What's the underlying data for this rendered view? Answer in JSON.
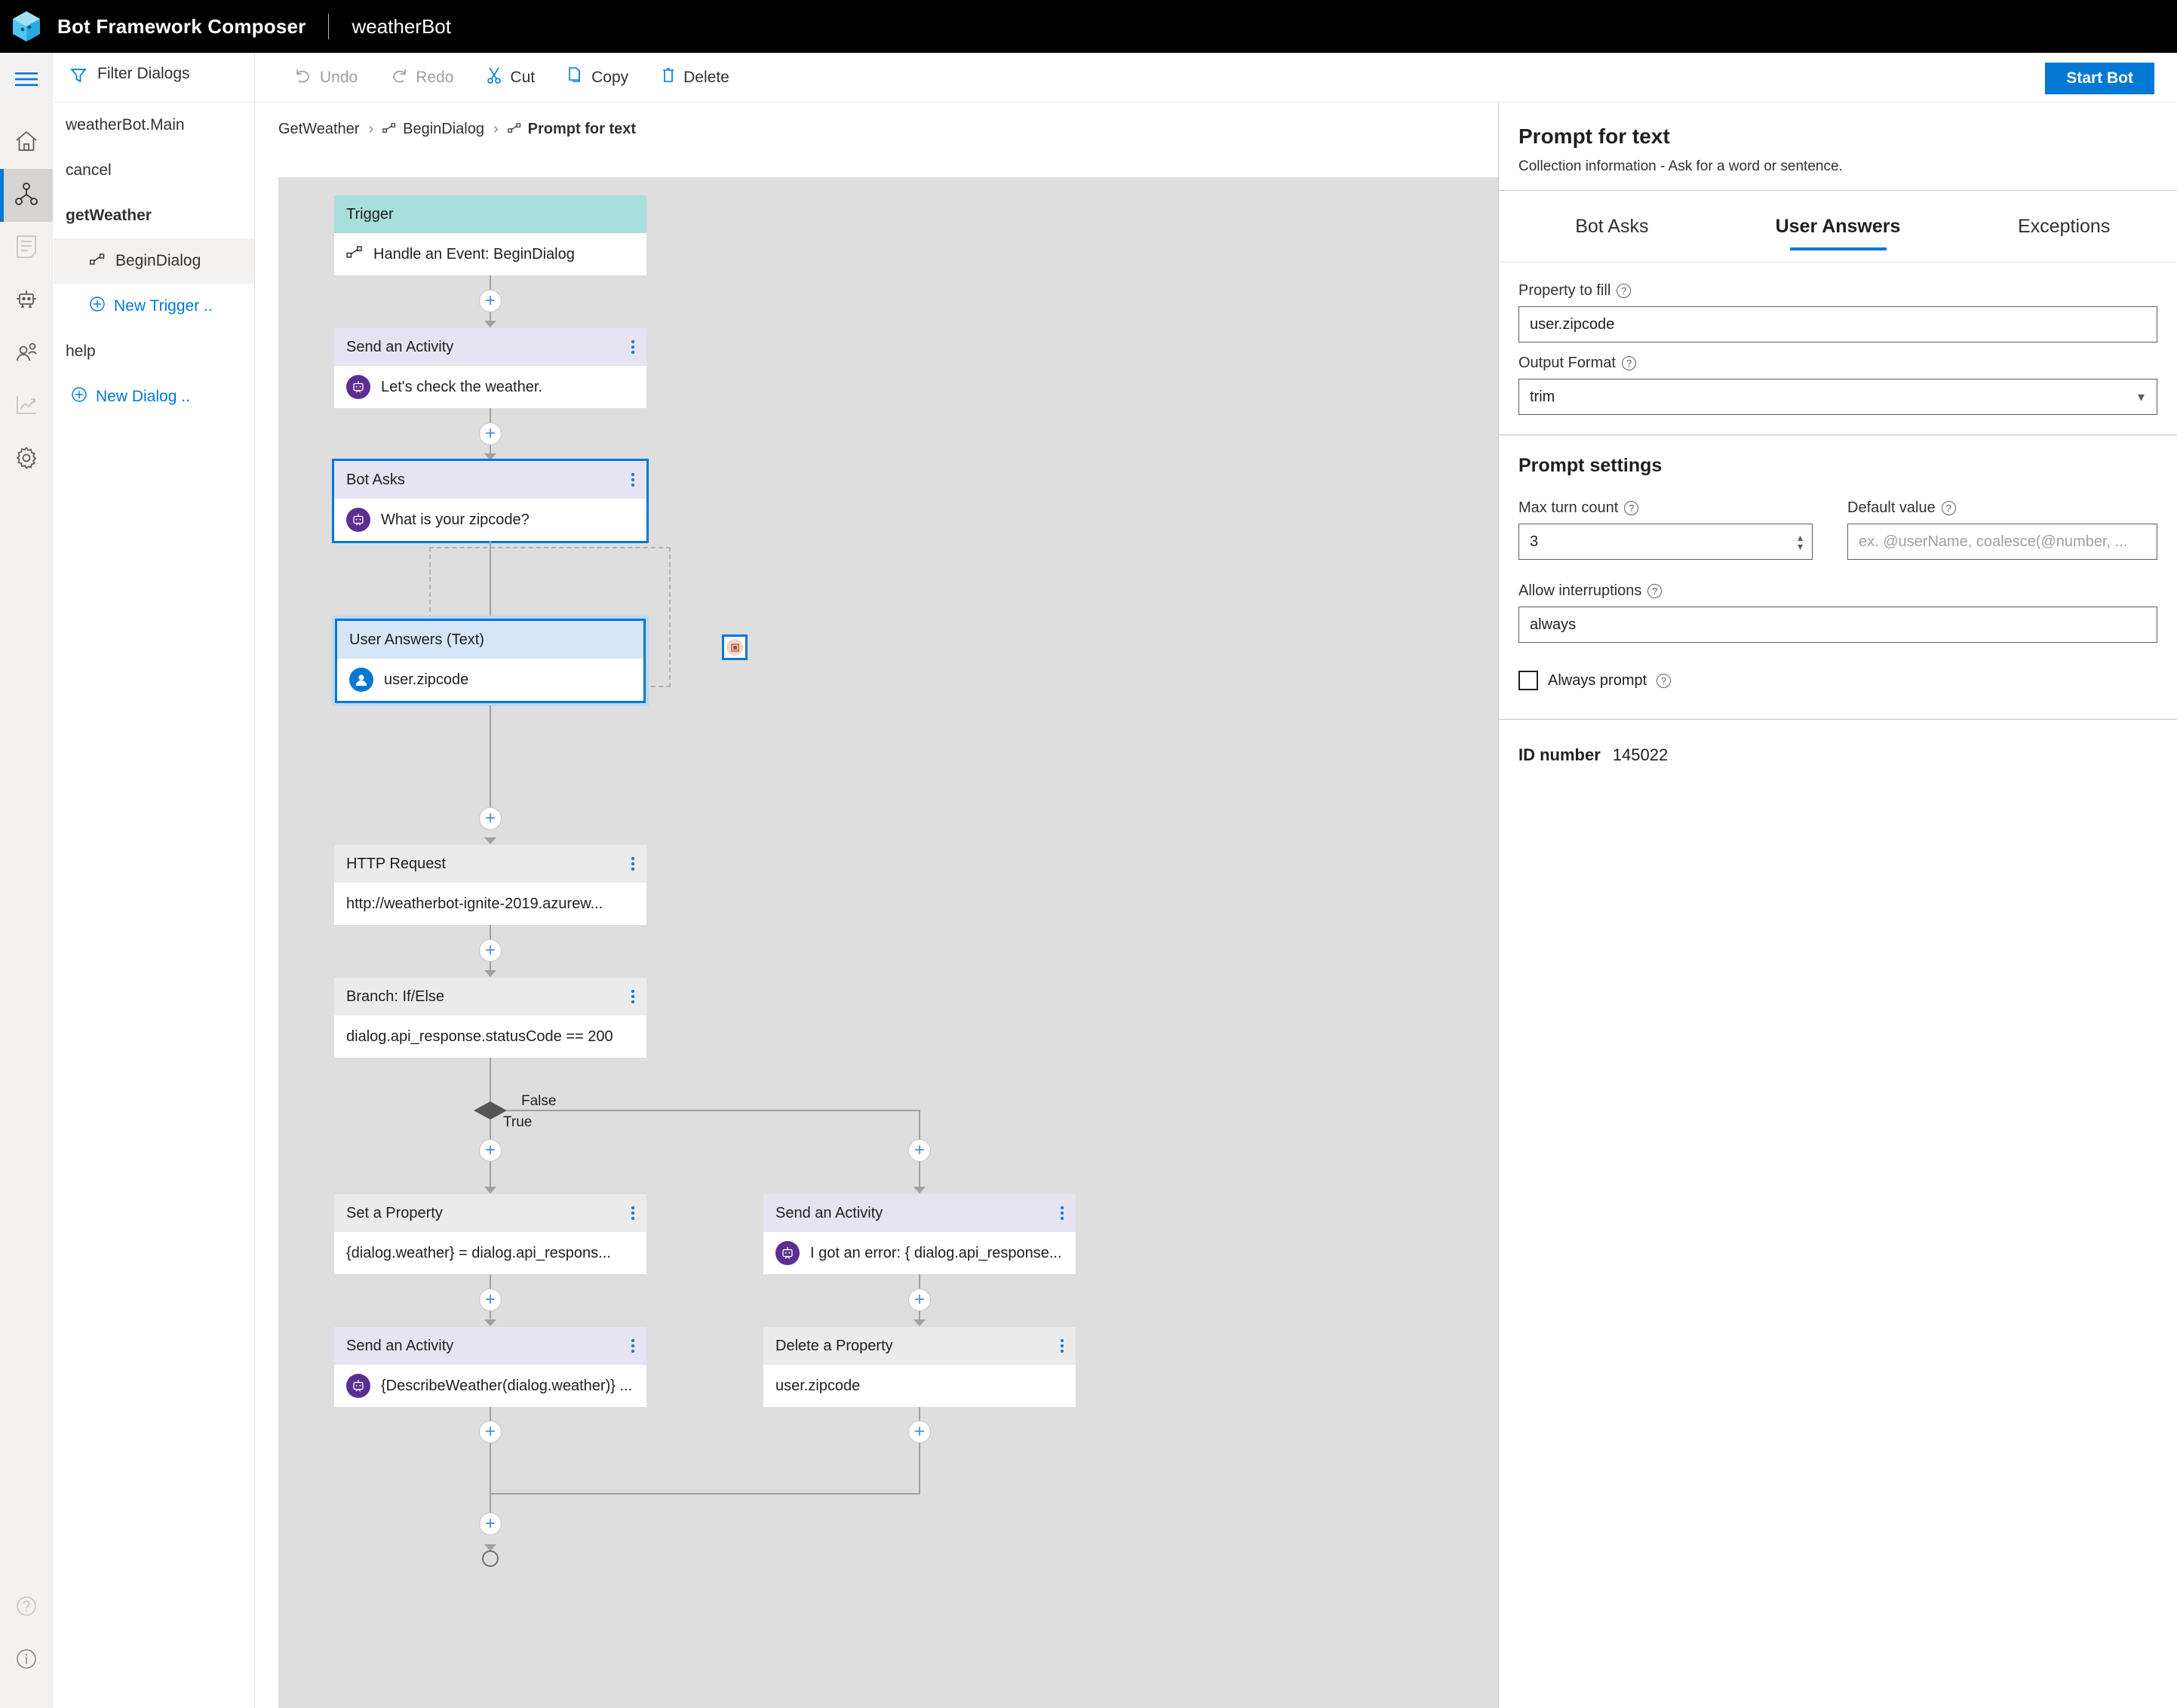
{
  "topbar": {
    "app_title": "Bot Framework Composer",
    "bot_name": "weatherBot",
    "logo_icon": "composer-cube-logo"
  },
  "rail": {
    "menu_icon": "hamburger-menu-icon",
    "items": [
      {
        "icon": "home-icon",
        "name": "home",
        "active": false,
        "disabled": false
      },
      {
        "icon": "dialog-flow-icon",
        "name": "design",
        "active": true,
        "disabled": false
      },
      {
        "icon": "content-list-icon",
        "name": "bot-responses",
        "active": false,
        "disabled": true
      },
      {
        "icon": "robot-icon",
        "name": "user-input",
        "active": false,
        "disabled": false
      },
      {
        "icon": "people-icon",
        "name": "skills",
        "active": false,
        "disabled": false
      },
      {
        "icon": "analytics-icon",
        "name": "evaluate-performance",
        "active": false,
        "disabled": true
      },
      {
        "icon": "gear-icon",
        "name": "settings",
        "active": false,
        "disabled": false
      }
    ],
    "bottom": [
      {
        "icon": "help-icon",
        "name": "help",
        "disabled": true
      },
      {
        "icon": "info-icon",
        "name": "about",
        "disabled": false
      }
    ]
  },
  "dialogs": {
    "filter_label": "Filter Dialogs",
    "filter_icon": "funnel-filter-icon",
    "items": [
      {
        "label": "weatherBot.Main",
        "level": 0,
        "bold": false,
        "selected": false,
        "type": "dialog"
      },
      {
        "label": "cancel",
        "level": 0,
        "bold": false,
        "selected": false,
        "type": "dialog"
      },
      {
        "label": "getWeather",
        "level": 0,
        "bold": true,
        "selected": false,
        "type": "dialog"
      },
      {
        "label": "BeginDialog",
        "level": 1,
        "bold": false,
        "selected": true,
        "type": "trigger",
        "icon": "trigger-flow-icon"
      },
      {
        "label": "New Trigger ..",
        "level": 1,
        "bold": false,
        "selected": false,
        "type": "link",
        "icon": "plus-circle-icon"
      },
      {
        "label": "help",
        "level": 0,
        "bold": false,
        "selected": false,
        "type": "dialog"
      },
      {
        "label": "New Dialog ..",
        "level": 0,
        "bold": false,
        "selected": false,
        "type": "link",
        "icon": "plus-circle-icon"
      }
    ]
  },
  "commandbar": {
    "items": [
      {
        "label": "Undo",
        "icon": "undo-icon",
        "disabled": true
      },
      {
        "label": "Redo",
        "icon": "redo-icon",
        "disabled": true
      },
      {
        "label": "Cut",
        "icon": "scissors-icon",
        "disabled": false
      },
      {
        "label": "Copy",
        "icon": "copy-icon",
        "disabled": false
      },
      {
        "label": "Delete",
        "icon": "trash-icon",
        "disabled": false
      }
    ],
    "start_bot_label": "Start Bot"
  },
  "breadcrumb": [
    {
      "label": "GetWeather",
      "icon": null,
      "bold": false
    },
    {
      "label": "BeginDialog",
      "icon": "trigger-flow-icon",
      "bold": false
    },
    {
      "label": "Prompt for text",
      "icon": "trigger-flow-icon",
      "bold": true
    }
  ],
  "canvas": {
    "nodes": {
      "trigger": {
        "header": "Trigger",
        "body": "Handle an Event: BeginDialog",
        "icon": "trigger-flow-icon"
      },
      "send_activity_1": {
        "header": "Send an Activity",
        "body": "Let's check the weather.",
        "icon": "bot-avatar-icon"
      },
      "bot_asks": {
        "header": "Bot Asks",
        "body": "What is your zipcode?",
        "icon": "bot-avatar-icon"
      },
      "user_answers": {
        "header": "User Answers (Text)",
        "body": "user.zipcode",
        "icon": "user-avatar-icon"
      },
      "http_request": {
        "header": "HTTP Request",
        "body": "http://weatherbot-ignite-2019.azurew..."
      },
      "branch": {
        "header": "Branch: If/Else",
        "body": "dialog.api_response.statusCode == 200"
      },
      "set_property": {
        "header": "Set a Property",
        "body": "{dialog.weather} = dialog.api_respons..."
      },
      "send_activity_true": {
        "header": "Send an Activity",
        "body": "{DescribeWeather(dialog.weather)} ...",
        "icon": "bot-avatar-icon"
      },
      "send_activity_false": {
        "header": "Send an Activity",
        "body": "I got an error: { dialog.api_response...",
        "icon": "bot-avatar-icon"
      },
      "delete_property": {
        "header": "Delete a Property",
        "body": "user.zipcode"
      }
    },
    "edge_labels": {
      "false": "False",
      "true": "True"
    },
    "exception_icon": "exception-node-icon",
    "add_icon": "plus-icon"
  },
  "properties": {
    "title": "Prompt for text",
    "subtitle": "Collection information - Ask for a word or sentence.",
    "tabs": [
      {
        "label": "Bot Asks",
        "active": false
      },
      {
        "label": "User Answers",
        "active": true
      },
      {
        "label": "Exceptions",
        "active": false
      }
    ],
    "property_to_fill": {
      "label": "Property to fill",
      "value": "user.zipcode"
    },
    "output_format": {
      "label": "Output Format",
      "value": "trim"
    },
    "prompt_settings_title": "Prompt settings",
    "max_turn_count": {
      "label": "Max turn count",
      "value": "3"
    },
    "default_value": {
      "label": "Default value",
      "value": "",
      "placeholder": "ex. @userName, coalesce(@number, ..."
    },
    "allow_interruptions": {
      "label": "Allow interruptions",
      "value": "always"
    },
    "always_prompt": {
      "label": "Always prompt",
      "checked": false
    },
    "id_number": {
      "label": "ID number",
      "value": "145022"
    }
  },
  "colors": {
    "accent": "#0078d4",
    "trigger_header": "#a8dedb",
    "activity_header": "#e6e3f3",
    "default_header": "#ebebeb",
    "user_header": "#d6e5f8",
    "bot_avatar": "#5c2e91",
    "user_avatar": "#0078d4",
    "canvas_bg": "#dedede",
    "topbar_bg": "#000000"
  }
}
